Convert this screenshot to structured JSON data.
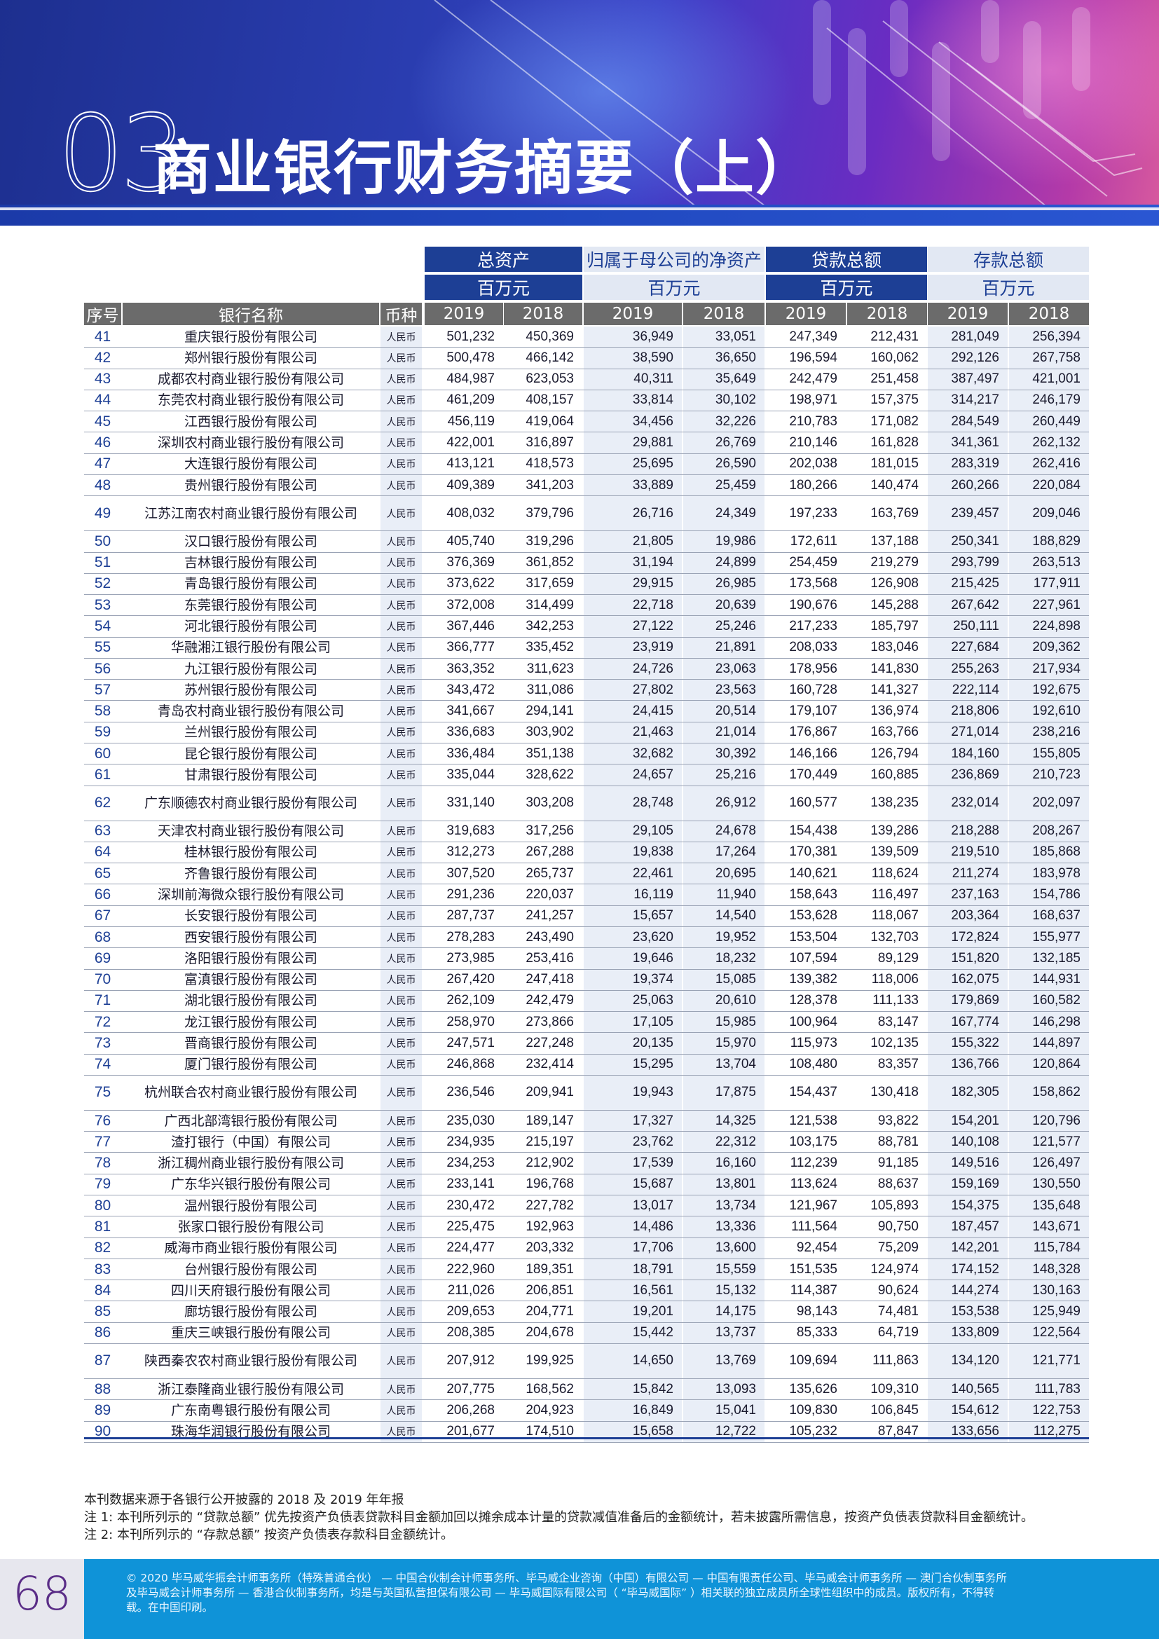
{
  "title": {
    "number": "03",
    "text": "商业银行财务摘要（上）"
  },
  "table": {
    "groups": [
      {
        "label": "总资产",
        "unit": "百万元",
        "style": "dark"
      },
      {
        "label": "归属于母公司的净资产",
        "unit": "百万元",
        "style": "light"
      },
      {
        "label": "贷款总额",
        "unit": "百万元",
        "style": "dark"
      },
      {
        "label": "存款总额",
        "unit": "百万元",
        "style": "light"
      }
    ],
    "columns": [
      "序号",
      "银行名称",
      "币种",
      "2019",
      "2018",
      "2019",
      "2018",
      "2019",
      "2018",
      "2019",
      "2018"
    ],
    "rows": [
      [
        "41",
        "重庆银行股份有限公司",
        "人民币",
        "501,232",
        "450,369",
        "36,949",
        "33,051",
        "247,349",
        "212,431",
        "281,049",
        "256,394"
      ],
      [
        "42",
        "郑州银行股份有限公司",
        "人民币",
        "500,478",
        "466,142",
        "38,590",
        "36,650",
        "196,594",
        "160,062",
        "292,126",
        "267,758"
      ],
      [
        "43",
        "成都农村商业银行股份有限公司",
        "人民币",
        "484,987",
        "623,053",
        "40,311",
        "35,649",
        "242,479",
        "251,458",
        "387,497",
        "421,001"
      ],
      [
        "44",
        "东莞农村商业银行股份有限公司",
        "人民币",
        "461,209",
        "408,157",
        "33,814",
        "30,102",
        "198,971",
        "157,375",
        "314,217",
        "246,179"
      ],
      [
        "45",
        "江西银行股份有限公司",
        "人民币",
        "456,119",
        "419,064",
        "34,456",
        "32,226",
        "210,783",
        "171,082",
        "284,549",
        "260,449"
      ],
      [
        "46",
        "深圳农村商业银行股份有限公司",
        "人民币",
        "422,001",
        "316,897",
        "29,881",
        "26,769",
        "210,146",
        "161,828",
        "341,361",
        "262,132"
      ],
      [
        "47",
        "大连银行股份有限公司",
        "人民币",
        "413,121",
        "418,573",
        "25,695",
        "26,590",
        "202,038",
        "181,015",
        "283,319",
        "262,416"
      ],
      [
        "48",
        "贵州银行股份有限公司",
        "人民币",
        "409,389",
        "341,203",
        "33,889",
        "25,459",
        "180,266",
        "140,474",
        "260,266",
        "220,084"
      ],
      [
        "49",
        "江苏江南农村商业银行股份有限公司",
        "人民币",
        "408,032",
        "379,796",
        "26,716",
        "24,349",
        "197,233",
        "163,769",
        "239,457",
        "209,046"
      ],
      [
        "50",
        "汉口银行股份有限公司",
        "人民币",
        "405,740",
        "319,296",
        "21,805",
        "19,986",
        "172,611",
        "137,188",
        "250,341",
        "188,829"
      ],
      [
        "51",
        "吉林银行股份有限公司",
        "人民币",
        "376,369",
        "361,852",
        "31,194",
        "24,899",
        "254,459",
        "219,279",
        "293,799",
        "263,513"
      ],
      [
        "52",
        "青岛银行股份有限公司",
        "人民币",
        "373,622",
        "317,659",
        "29,915",
        "26,985",
        "173,568",
        "126,908",
        "215,425",
        "177,911"
      ],
      [
        "53",
        "东莞银行股份有限公司",
        "人民币",
        "372,008",
        "314,499",
        "22,718",
        "20,639",
        "190,676",
        "145,288",
        "267,642",
        "227,961"
      ],
      [
        "54",
        "河北银行股份有限公司",
        "人民币",
        "367,446",
        "342,253",
        "27,122",
        "25,246",
        "217,233",
        "185,797",
        "250,111",
        "224,898"
      ],
      [
        "55",
        "华融湘江银行股份有限公司",
        "人民币",
        "366,777",
        "335,452",
        "23,919",
        "21,891",
        "208,033",
        "183,046",
        "227,684",
        "209,362"
      ],
      [
        "56",
        "九江银行股份有限公司",
        "人民币",
        "363,352",
        "311,623",
        "24,726",
        "23,063",
        "178,956",
        "141,830",
        "255,263",
        "217,934"
      ],
      [
        "57",
        "苏州银行股份有限公司",
        "人民币",
        "343,472",
        "311,086",
        "27,802",
        "23,563",
        "160,728",
        "141,327",
        "222,114",
        "192,675"
      ],
      [
        "58",
        "青岛农村商业银行股份有限公司",
        "人民币",
        "341,667",
        "294,141",
        "24,415",
        "20,514",
        "179,107",
        "136,974",
        "218,806",
        "192,610"
      ],
      [
        "59",
        "兰州银行股份有限公司",
        "人民币",
        "336,683",
        "303,902",
        "21,463",
        "21,014",
        "176,867",
        "163,766",
        "271,014",
        "238,216"
      ],
      [
        "60",
        "昆仑银行股份有限公司",
        "人民币",
        "336,484",
        "351,138",
        "32,682",
        "30,392",
        "146,166",
        "126,794",
        "184,160",
        "155,805"
      ],
      [
        "61",
        "甘肃银行股份有限公司",
        "人民币",
        "335,044",
        "328,622",
        "24,657",
        "25,216",
        "170,449",
        "160,885",
        "236,869",
        "210,723"
      ],
      [
        "62",
        "广东顺德农村商业银行股份有限公司",
        "人民币",
        "331,140",
        "303,208",
        "28,748",
        "26,912",
        "160,577",
        "138,235",
        "232,014",
        "202,097"
      ],
      [
        "63",
        "天津农村商业银行股份有限公司",
        "人民币",
        "319,683",
        "317,256",
        "29,105",
        "24,678",
        "154,438",
        "139,286",
        "218,288",
        "208,267"
      ],
      [
        "64",
        "桂林银行股份有限公司",
        "人民币",
        "312,273",
        "267,288",
        "19,838",
        "17,264",
        "170,381",
        "139,509",
        "219,510",
        "185,868"
      ],
      [
        "65",
        "齐鲁银行股份有限公司",
        "人民币",
        "307,520",
        "265,737",
        "22,461",
        "20,695",
        "140,621",
        "118,624",
        "211,274",
        "183,978"
      ],
      [
        "66",
        "深圳前海微众银行股份有限公司",
        "人民币",
        "291,236",
        "220,037",
        "16,119",
        "11,940",
        "158,643",
        "116,497",
        "237,163",
        "154,786"
      ],
      [
        "67",
        "长安银行股份有限公司",
        "人民币",
        "287,737",
        "241,257",
        "15,657",
        "14,540",
        "153,628",
        "118,067",
        "203,364",
        "168,637"
      ],
      [
        "68",
        "西安银行股份有限公司",
        "人民币",
        "278,283",
        "243,490",
        "23,620",
        "19,952",
        "153,504",
        "132,703",
        "172,824",
        "155,977"
      ],
      [
        "69",
        "洛阳银行股份有限公司",
        "人民币",
        "273,985",
        "253,416",
        "19,646",
        "18,232",
        "107,594",
        "89,129",
        "151,820",
        "132,185"
      ],
      [
        "70",
        "富滇银行股份有限公司",
        "人民币",
        "267,420",
        "247,418",
        "19,374",
        "15,085",
        "139,382",
        "118,006",
        "162,075",
        "144,931"
      ],
      [
        "71",
        "湖北银行股份有限公司",
        "人民币",
        "262,109",
        "242,479",
        "25,063",
        "20,610",
        "128,378",
        "111,133",
        "179,869",
        "160,582"
      ],
      [
        "72",
        "龙江银行股份有限公司",
        "人民币",
        "258,970",
        "273,866",
        "17,105",
        "15,985",
        "100,964",
        "83,147",
        "167,774",
        "146,298"
      ],
      [
        "73",
        "晋商银行股份有限公司",
        "人民币",
        "247,571",
        "227,248",
        "20,135",
        "15,970",
        "115,973",
        "102,135",
        "155,322",
        "144,897"
      ],
      [
        "74",
        "厦门银行股份有限公司",
        "人民币",
        "246,868",
        "232,414",
        "15,295",
        "13,704",
        "108,480",
        "83,357",
        "136,766",
        "120,864"
      ],
      [
        "75",
        "杭州联合农村商业银行股份有限公司",
        "人民币",
        "236,546",
        "209,941",
        "19,943",
        "17,875",
        "154,437",
        "130,418",
        "182,305",
        "158,862"
      ],
      [
        "76",
        "广西北部湾银行股份有限公司",
        "人民币",
        "235,030",
        "189,147",
        "17,327",
        "14,325",
        "121,538",
        "93,822",
        "154,201",
        "120,796"
      ],
      [
        "77",
        "渣打银行（中国）有限公司",
        "人民币",
        "234,935",
        "215,197",
        "23,762",
        "22,312",
        "103,175",
        "88,781",
        "140,108",
        "121,577"
      ],
      [
        "78",
        "浙江稠州商业银行股份有限公司",
        "人民币",
        "234,253",
        "212,902",
        "17,539",
        "16,160",
        "112,239",
        "91,185",
        "149,516",
        "126,497"
      ],
      [
        "79",
        "广东华兴银行股份有限公司",
        "人民币",
        "233,141",
        "196,768",
        "15,687",
        "13,801",
        "113,624",
        "88,637",
        "159,169",
        "130,550"
      ],
      [
        "80",
        "温州银行股份有限公司",
        "人民币",
        "230,472",
        "227,782",
        "13,017",
        "13,734",
        "121,967",
        "105,893",
        "154,375",
        "135,648"
      ],
      [
        "81",
        "张家口银行股份有限公司",
        "人民币",
        "225,475",
        "192,963",
        "14,486",
        "13,336",
        "111,564",
        "90,750",
        "187,457",
        "143,671"
      ],
      [
        "82",
        "威海市商业银行股份有限公司",
        "人民币",
        "224,477",
        "203,332",
        "17,706",
        "13,600",
        "92,454",
        "75,209",
        "142,201",
        "115,784"
      ],
      [
        "83",
        "台州银行股份有限公司",
        "人民币",
        "222,960",
        "189,351",
        "18,791",
        "15,559",
        "151,535",
        "124,974",
        "174,152",
        "148,328"
      ],
      [
        "84",
        "四川天府银行股份有限公司",
        "人民币",
        "211,026",
        "206,851",
        "16,561",
        "15,132",
        "114,387",
        "90,624",
        "144,274",
        "130,163"
      ],
      [
        "85",
        "廊坊银行股份有限公司",
        "人民币",
        "209,653",
        "204,771",
        "19,201",
        "14,175",
        "98,143",
        "74,481",
        "153,538",
        "125,949"
      ],
      [
        "86",
        "重庆三峡银行股份有限公司",
        "人民币",
        "208,385",
        "204,678",
        "15,442",
        "13,737",
        "85,333",
        "64,719",
        "133,809",
        "122,564"
      ],
      [
        "87",
        "陕西秦农农村商业银行股份有限公司",
        "人民币",
        "207,912",
        "199,925",
        "14,650",
        "13,769",
        "109,694",
        "111,863",
        "134,120",
        "121,771"
      ],
      [
        "88",
        "浙江泰隆商业银行股份有限公司",
        "人民币",
        "207,775",
        "168,562",
        "15,842",
        "13,093",
        "135,626",
        "109,310",
        "140,565",
        "111,783"
      ],
      [
        "89",
        "广东南粤银行股份有限公司",
        "人民币",
        "206,268",
        "204,923",
        "16,849",
        "15,041",
        "109,830",
        "106,845",
        "154,612",
        "122,753"
      ],
      [
        "90",
        "珠海华润银行股份有限公司",
        "人民币",
        "201,677",
        "174,510",
        "15,658",
        "12,722",
        "105,232",
        "87,847",
        "133,656",
        "112,275"
      ]
    ]
  },
  "notes": [
    "本刊数据来源于各银行公开披露的 2018 及 2019 年年报",
    "注 1: 本刊所列示的 “贷款总额” 优先按资产负债表贷款科目金额加回以摊余成本计量的贷款减值准备后的金额统计，若未披露所需信息，按资产负债表贷款科目金额统计。",
    "注 2: 本刊所列示的 “存款总额” 按资产负债表存款科目金额统计。"
  ],
  "footer": {
    "page_number": "68",
    "copyright": "© 2020 毕马威华振会计师事务所（特殊普通合伙） — 中国合伙制会计师事务所、毕马威企业咨询（中国）有限公司 — 中国有限责任公司、毕马威会计师事务所 — 澳门合伙制事务所及毕马威会计师事务所 — 香港合伙制事务所，均是与英国私营担保有限公司 — 毕马威国际有限公司（ “毕马威国际” ）相关联的独立成员所全球性组织中的成员。版权所有，不得转载。在中国印刷。"
  },
  "colors": {
    "dark_blue": "#1d3f95",
    "light_blue": "#e2e8f3",
    "gray_header": "#6b6b6b",
    "footer_blue": "#0f93d8",
    "page_num_purple": "#5a2d87"
  }
}
